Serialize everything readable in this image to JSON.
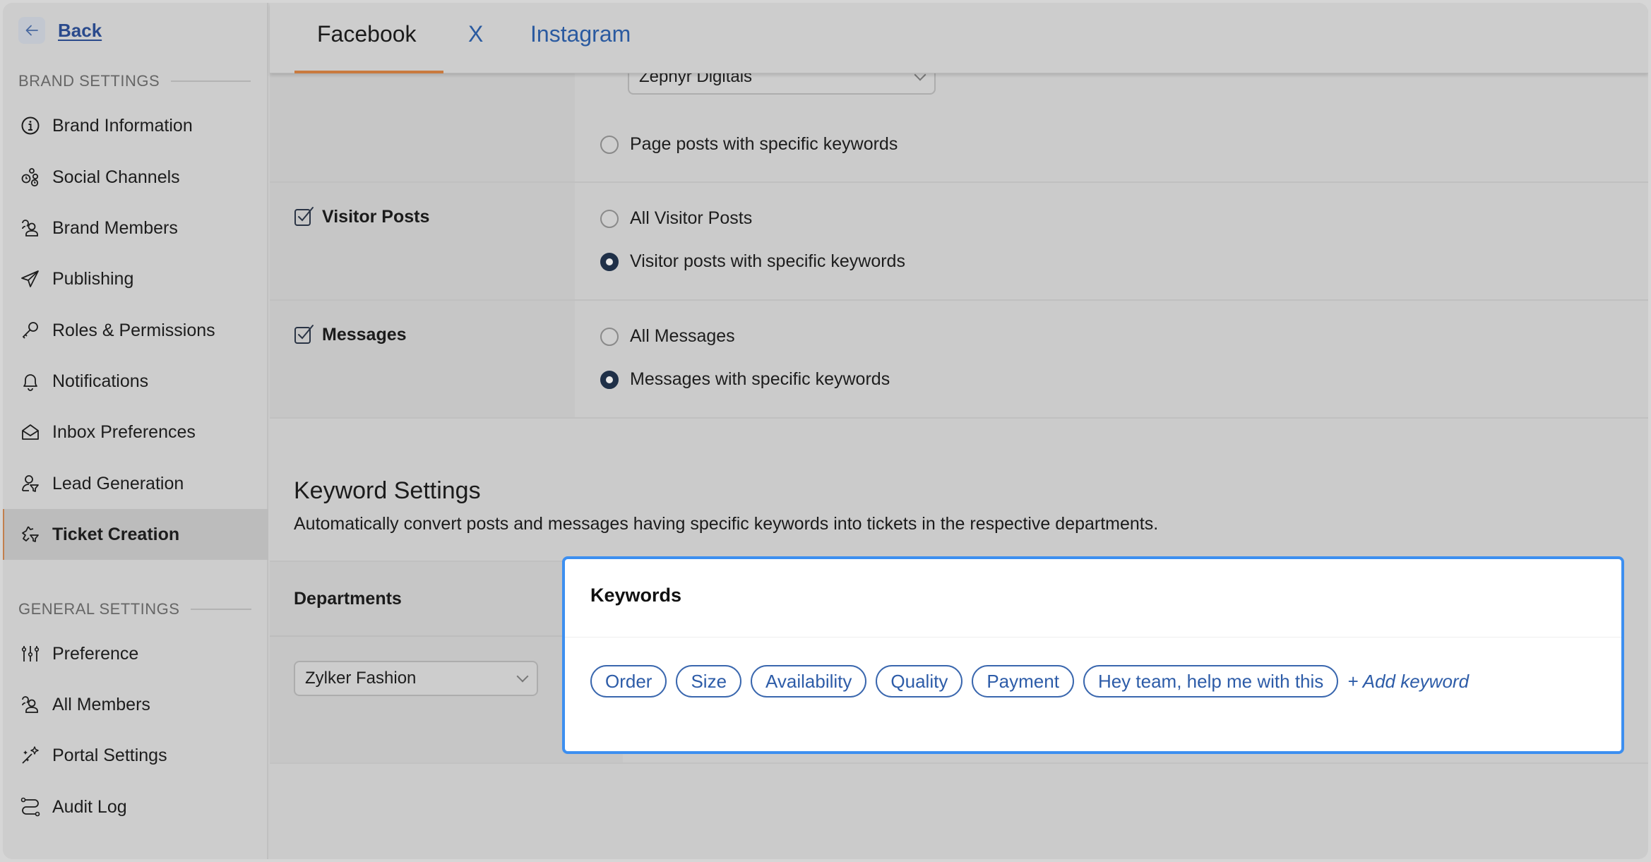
{
  "sidebar": {
    "back_label": "Back",
    "brand_settings_heading": "BRAND SETTINGS",
    "general_settings_heading": "GENERAL SETTINGS",
    "brand_items": [
      {
        "label": "Brand Information",
        "icon": "info-icon"
      },
      {
        "label": "Social Channels",
        "icon": "social-channels-icon"
      },
      {
        "label": "Brand Members",
        "icon": "members-icon"
      },
      {
        "label": "Publishing",
        "icon": "send-icon"
      },
      {
        "label": "Roles & Permissions",
        "icon": "key-icon"
      },
      {
        "label": "Notifications",
        "icon": "bell-icon"
      },
      {
        "label": "Inbox Preferences",
        "icon": "open-envelope-icon"
      },
      {
        "label": "Lead Generation",
        "icon": "user-funnel-icon"
      },
      {
        "label": "Ticket Creation",
        "icon": "ticket-funnel-icon",
        "active": true
      }
    ],
    "general_items": [
      {
        "label": "Preference",
        "icon": "sliders-icon"
      },
      {
        "label": "All Members",
        "icon": "members-icon"
      },
      {
        "label": "Portal Settings",
        "icon": "magic-wand-icon"
      },
      {
        "label": "Audit Log",
        "icon": "route-icon"
      }
    ]
  },
  "tabs": [
    {
      "label": "Facebook",
      "active": true
    },
    {
      "label": "X",
      "active": false
    },
    {
      "label": "Instagram",
      "active": false
    }
  ],
  "page_posts": {
    "page_select_value": "Zephyr Digitals",
    "option_keywords": "Page posts with specific keywords",
    "option_keywords_selected": false
  },
  "visitor_posts": {
    "label": "Visitor Posts",
    "checked": true,
    "options": [
      {
        "label": "All Visitor Posts",
        "selected": false
      },
      {
        "label": "Visitor posts with specific keywords",
        "selected": true
      }
    ]
  },
  "messages": {
    "label": "Messages",
    "checked": true,
    "options": [
      {
        "label": "All Messages",
        "selected": false
      },
      {
        "label": "Messages with specific keywords",
        "selected": true
      }
    ]
  },
  "keyword_settings": {
    "title": "Keyword Settings",
    "description": "Automatically convert posts and messages having specific keywords into tickets in the respective departments.",
    "departments_header": "Departments",
    "department_value": "Zylker Fashion",
    "keywords_header": "Keywords",
    "keywords": [
      "Order",
      "Size",
      "Availability",
      "Quality",
      "Payment",
      "Hey team, help me with this"
    ],
    "add_keyword_label": "+ Add keyword"
  },
  "colors": {
    "accent_tab_underline": "#c97a3f",
    "link_blue": "#2d5ca8",
    "focus_border": "#3d8ff0",
    "radio_selected": "#1f3048"
  }
}
